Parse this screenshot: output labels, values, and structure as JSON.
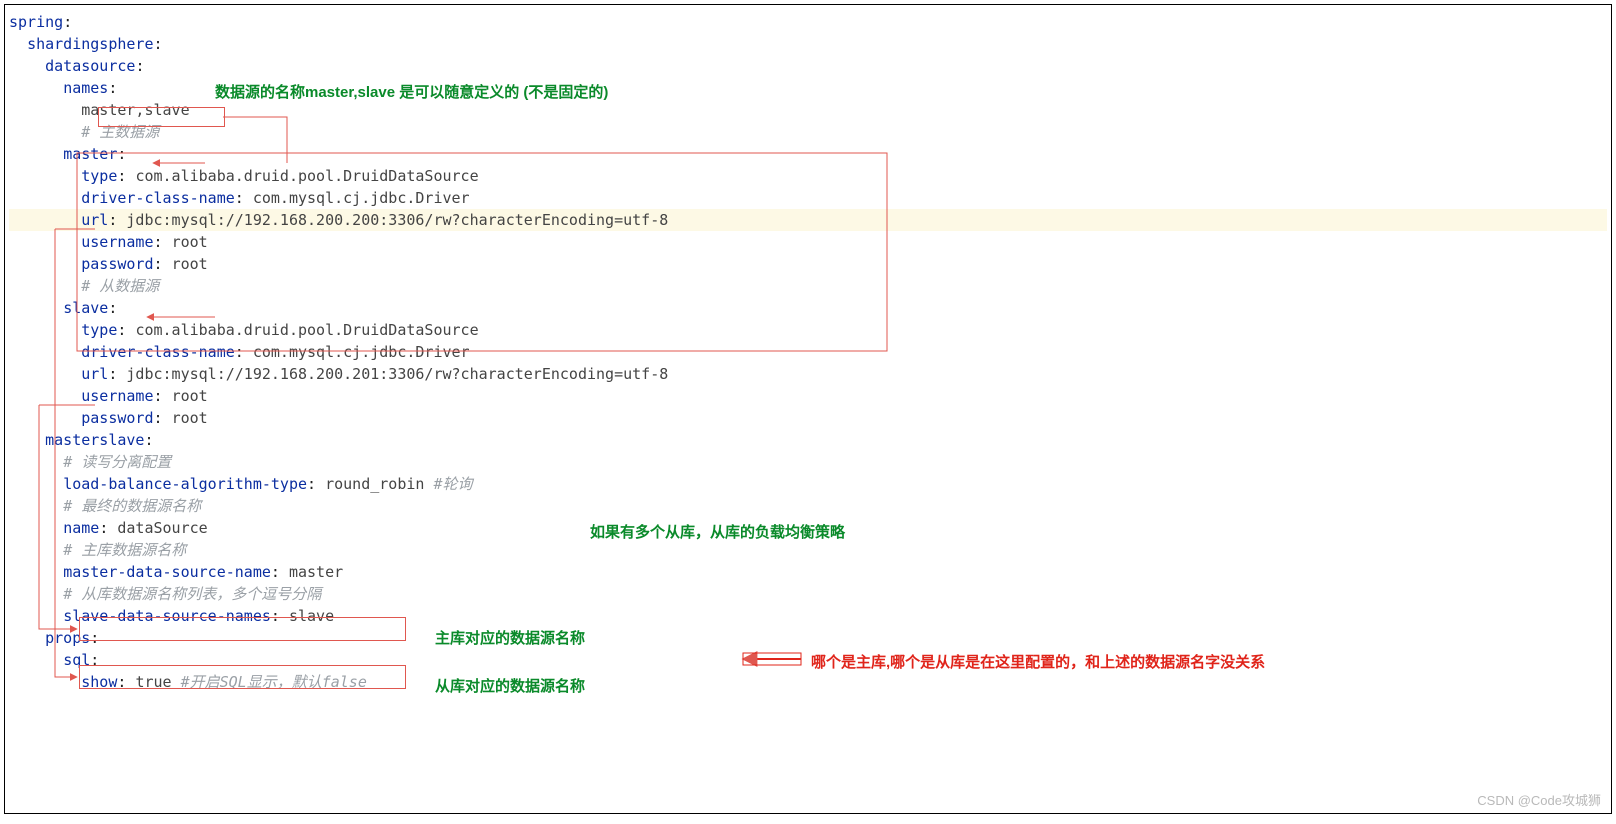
{
  "lines": [
    {
      "gutter": "",
      "key": "spring",
      "colon": ":",
      "val": "",
      "cls": ""
    },
    {
      "gutter": "  ",
      "key": "shardingsphere",
      "colon": ":",
      "val": "",
      "cls": ""
    },
    {
      "gutter": "    ",
      "key": "datasource",
      "colon": ":",
      "val": "",
      "cls": ""
    },
    {
      "gutter": "      ",
      "key": "names",
      "colon": ":",
      "val": "",
      "cls": ""
    },
    {
      "gutter": "        ",
      "key": "",
      "colon": "",
      "val": "master,slave",
      "cls": "names-val"
    },
    {
      "gutter": "        ",
      "comment": "# 主数据源"
    },
    {
      "gutter": "      ",
      "key": "master",
      "colon": ":",
      "val": "",
      "cls": ""
    },
    {
      "gutter": "        ",
      "key": "type",
      "colon": ": ",
      "val": "com.alibaba.druid.pool.DruidDataSource",
      "cls": ""
    },
    {
      "gutter": "        ",
      "key": "driver-class-name",
      "colon": ": ",
      "val": "com.mysql.cj.jdbc.Driver",
      "cls": ""
    },
    {
      "gutter": "        ",
      "key": "url",
      "colon": ": ",
      "val": "jdbc:mysql://192.168.200.200:3306/rw?characterEncoding=utf-8",
      "cls": "hl"
    },
    {
      "gutter": "        ",
      "key": "username",
      "colon": ": ",
      "val": "root",
      "cls": ""
    },
    {
      "gutter": "        ",
      "key": "password",
      "colon": ": ",
      "val": "root",
      "cls": ""
    },
    {
      "gutter": "        ",
      "comment": "# 从数据源"
    },
    {
      "gutter": "      ",
      "key": "slave",
      "colon": ":",
      "val": "",
      "cls": ""
    },
    {
      "gutter": "        ",
      "key": "type",
      "colon": ": ",
      "val": "com.alibaba.druid.pool.DruidDataSource",
      "cls": ""
    },
    {
      "gutter": "        ",
      "key": "driver-class-name",
      "colon": ": ",
      "val": "com.mysql.cj.jdbc.Driver",
      "cls": ""
    },
    {
      "gutter": "        ",
      "key": "url",
      "colon": ": ",
      "val": "jdbc:mysql://192.168.200.201:3306/rw?characterEncoding=utf-8",
      "cls": ""
    },
    {
      "gutter": "        ",
      "key": "username",
      "colon": ": ",
      "val": "root",
      "cls": ""
    },
    {
      "gutter": "        ",
      "key": "password",
      "colon": ": ",
      "val": "root",
      "cls": ""
    },
    {
      "gutter": "    ",
      "key": "masterslave",
      "colon": ":",
      "val": "",
      "cls": ""
    },
    {
      "gutter": "      ",
      "comment": "# 读写分离配置"
    },
    {
      "gutter": "      ",
      "key": "load-balance-algorithm-type",
      "colon": ": ",
      "val": "round_robin ",
      "tail_comment": "#轮询",
      "cls": ""
    },
    {
      "gutter": "      ",
      "comment": "# 最终的数据源名称"
    },
    {
      "gutter": "      ",
      "key": "name",
      "colon": ": ",
      "val": "dataSource",
      "cls": ""
    },
    {
      "gutter": "      ",
      "comment": "# 主库数据源名称"
    },
    {
      "gutter": "      ",
      "key": "master-data-source-name",
      "colon": ": ",
      "val": "master",
      "cls": ""
    },
    {
      "gutter": "      ",
      "comment": "# 从库数据源名称列表，多个逗号分隔"
    },
    {
      "gutter": "      ",
      "key": "slave-data-source-names",
      "colon": ": ",
      "val": "slave",
      "cls": ""
    },
    {
      "gutter": "    ",
      "key": "props",
      "colon": ":",
      "val": "",
      "cls": ""
    },
    {
      "gutter": "      ",
      "key": "sql",
      "colon": ":",
      "val": "",
      "cls": ""
    },
    {
      "gutter": "        ",
      "key": "show",
      "colon": ": ",
      "val": "true ",
      "tail_comment": "#开启SQL显示，默认false",
      "cls": ""
    }
  ],
  "annotations": {
    "top": "数据源的名称master,slave 是可以随意定义的 (不是固定的)",
    "lb": "如果有多个从库，从库的负载均衡策略",
    "master_ds": "主库对应的数据源名称",
    "slave_ds": "从库对应的数据源名称",
    "right_red": "哪个是主库,哪个是从库是在这里配置的，和上述的数据源名字没关系"
  },
  "watermark": "CSDN @Code攻城狮"
}
